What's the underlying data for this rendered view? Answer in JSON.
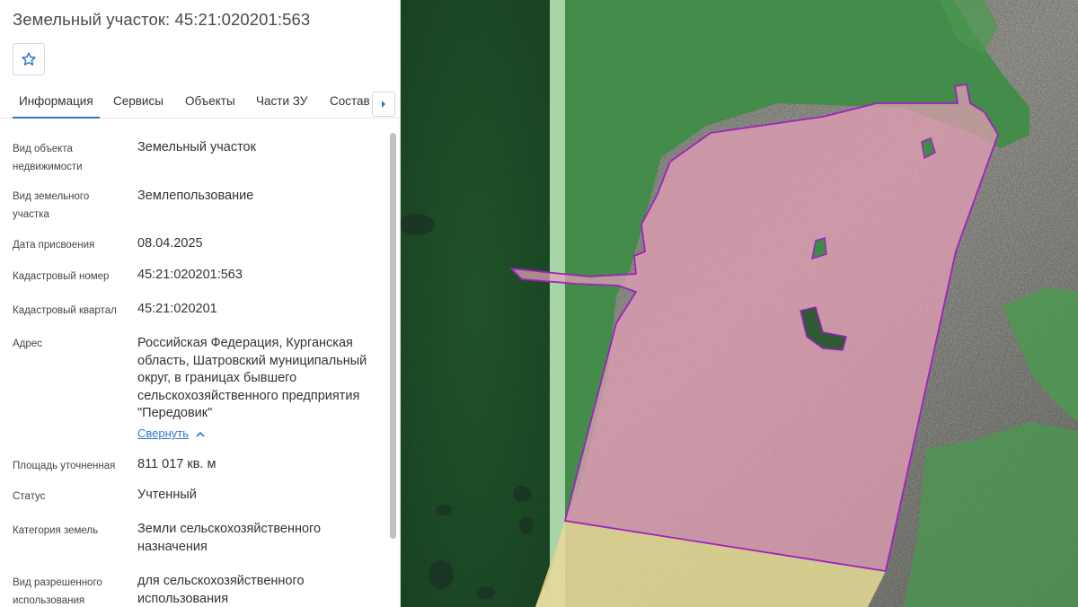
{
  "panel": {
    "title": "Земельный участок: 45:21:020201:563",
    "favorite_icon": "star-outline-icon",
    "tabs": [
      "Информация",
      "Сервисы",
      "Объекты",
      "Части ЗУ",
      "Состав"
    ],
    "active_tab": "Информация",
    "tabs_next_icon": "caret-right-icon",
    "collapse_label": "Свернуть",
    "collapse_icon": "chevron-up-icon",
    "fields": [
      {
        "label": "Вид объекта недвижимости",
        "value": "Земельный участок"
      },
      {
        "label": "Вид земельного участка",
        "value": "Землепользование"
      },
      {
        "label": "Дата присвоения",
        "value": "08.04.2025"
      },
      {
        "label": "Кадастровый номер",
        "value": "45:21:020201:563"
      },
      {
        "label": "Кадастровый квартал",
        "value": "45:21:020201"
      },
      {
        "label": "Адрес",
        "value": "Российская Федерация, Курганская область, Шатровский муниципальный округ, в границах бывшего сельскохозяйственного предприятия \"Передовик\""
      },
      {
        "label": "Площадь уточненная",
        "value": "811 017 кв. м"
      },
      {
        "label": "Статус",
        "value": "Учтенный"
      },
      {
        "label": "Категория земель",
        "value": "Земли сельскохозяйственного назначения"
      },
      {
        "label": "Вид разрешенного использования",
        "value": "для сельскохозяйственного использования"
      }
    ]
  },
  "colors": {
    "accent": "#2f77c9",
    "parcel_border": "#a020c0",
    "parcel_fill": "#e8a0b8",
    "forest_fill": "#3d8a45",
    "agri_zone_fill": "#e6dca0"
  }
}
